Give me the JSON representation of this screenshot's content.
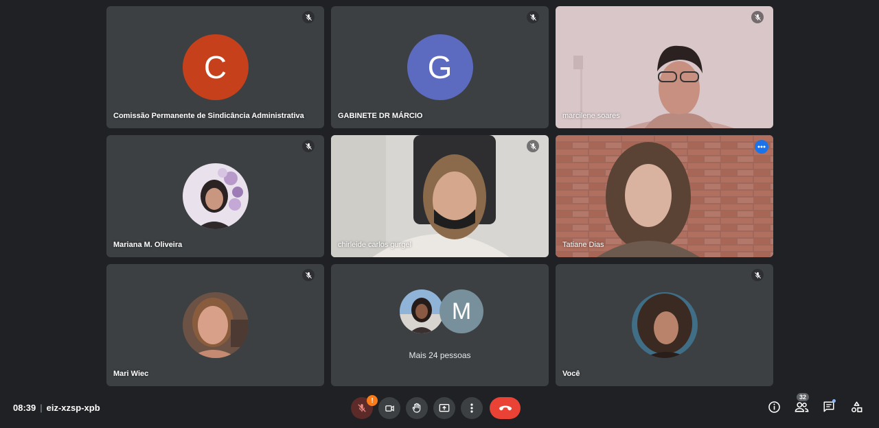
{
  "participants": [
    {
      "name": "Comissão Permanente de Sindicância Administrativa",
      "initial": "C",
      "avatar_color": "#c5401b"
    },
    {
      "name": "GABINETE DR MÁRCIO",
      "initial": "G",
      "avatar_color": "#5c6bc0"
    },
    {
      "name": "marcilene soares"
    },
    {
      "name": "Mariana M. Oliveira"
    },
    {
      "name": "chirleide carlos gurgel"
    },
    {
      "name": "Tatiane Dias"
    },
    {
      "name": "Mari Wiec"
    },
    {
      "more_label": "Mais 24 pessoas",
      "initial": "M",
      "avatar_color": "#78909c"
    },
    {
      "name": "Você"
    }
  ],
  "meeting": {
    "time": "08:39",
    "code": "eiz-xzsp-xpb"
  },
  "participant_count": "32",
  "controls": {
    "mic": "mic-off-icon",
    "camera": "camera-icon",
    "hand": "raise-hand-icon",
    "present": "present-icon",
    "more": "more-options-icon",
    "end": "end-call-icon",
    "warning": "!"
  },
  "colors": {
    "background": "#202124",
    "tile": "#3c4043",
    "end_call": "#ea4335",
    "active_border": "#8ab4f8"
  }
}
